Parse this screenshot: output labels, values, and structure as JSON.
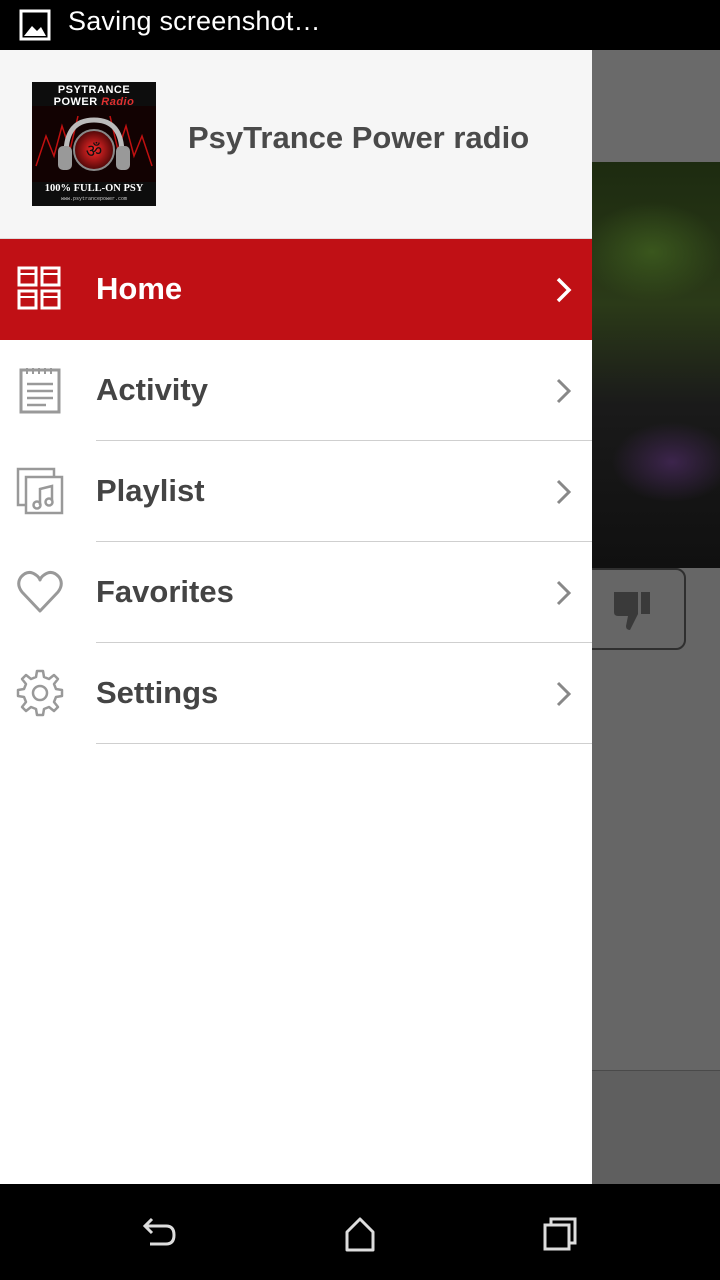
{
  "status_bar": {
    "text": "Saving screenshot…",
    "icon": "image-icon"
  },
  "drawer": {
    "title": "PsyTrance Power radio",
    "logo": {
      "line1": "PSYTRANCE",
      "line2": "POWER",
      "line2_script": "Radio",
      "tagline": "100% FULL-ON PSY",
      "url": "www.psytrancepower.com"
    },
    "menu": [
      {
        "label": "Home",
        "icon": "grid-icon",
        "active": true
      },
      {
        "label": "Activity",
        "icon": "notepad-icon",
        "active": false
      },
      {
        "label": "Playlist",
        "icon": "music-gallery-icon",
        "active": false
      },
      {
        "label": "Favorites",
        "icon": "heart-icon",
        "active": false
      },
      {
        "label": "Settings",
        "icon": "gear-icon",
        "active": false
      }
    ]
  },
  "background_app": {
    "button_icon": "thumbs-down-icon"
  },
  "nav_bar": {
    "back": "back-icon",
    "home": "home-icon",
    "recents": "recents-icon"
  },
  "colors": {
    "accent": "#c01015",
    "menu_text": "#444444",
    "header_bg": "#f6f6f6",
    "scrim": "#666666"
  }
}
